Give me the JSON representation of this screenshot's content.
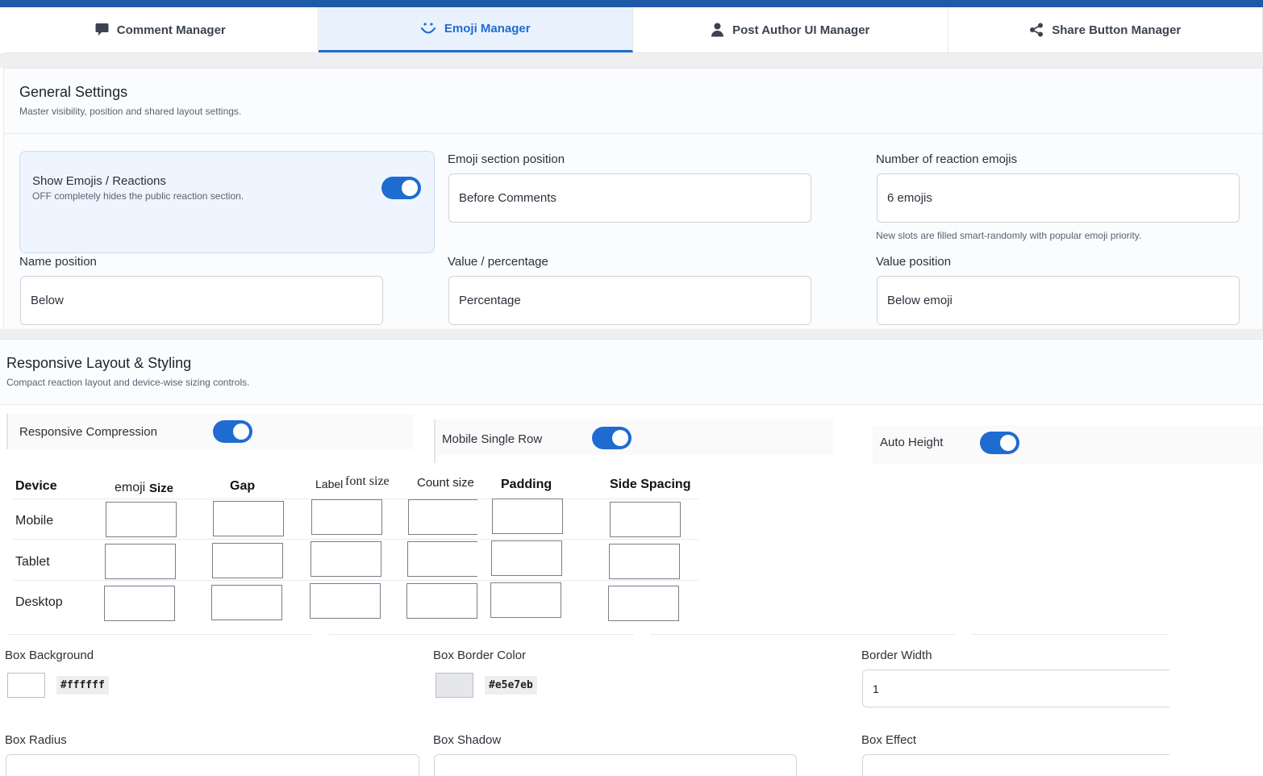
{
  "tabs": [
    {
      "label": "Comment Manager",
      "icon": "comment-icon",
      "active": false
    },
    {
      "label": "Emoji Manager",
      "icon": "smile-icon",
      "active": true
    },
    {
      "label": "Post Author UI Manager",
      "icon": "user-icon",
      "active": false
    },
    {
      "label": "Share Button Manager",
      "icon": "share-icon",
      "active": false
    }
  ],
  "general": {
    "title": "General Settings",
    "subtitle": "Master visibility, position and shared layout settings.",
    "show_emojis": {
      "label": "Show Emojis / Reactions",
      "help": "OFF completely hides the public reaction section.",
      "enabled": true
    },
    "emoji_position": {
      "label": "Emoji section position",
      "value": "Before Comments"
    },
    "emoji_count": {
      "label": "Number of reaction emojis",
      "value": "6 emojis",
      "help": "New slots are filled smart-randomly with popular emoji priority."
    },
    "name_position": {
      "label": "Name position",
      "value": "Below"
    },
    "value_type": {
      "label": "Value / percentage",
      "value": "Percentage"
    },
    "value_position": {
      "label": "Value position",
      "value": "Below emoji"
    }
  },
  "responsive": {
    "title": "Responsive Layout & Styling",
    "subtitle": "Compact reaction layout and device-wise sizing controls.",
    "toggles": [
      {
        "label": "Responsive Compression",
        "enabled": true
      },
      {
        "label": "Mobile Single Row",
        "enabled": true
      },
      {
        "label": "Auto Height",
        "enabled": true
      }
    ],
    "table": {
      "headers": {
        "device": "Device",
        "emoji_a": "emoji",
        "emoji_b": "Size",
        "gap": "Gap",
        "label_a": "Label",
        "label_b": "font size",
        "count": "Count size",
        "padding": "Padding",
        "side": "Side Spacing"
      },
      "rows": [
        "Mobile",
        "Tablet",
        "Desktop"
      ]
    },
    "box_background": {
      "label": "Box Background",
      "value": "#ffffff",
      "color": "#ffffff"
    },
    "box_border_color": {
      "label": "Box Border Color",
      "value": "#e5e7eb",
      "color": "#e5e7eb"
    },
    "border_width": {
      "label": "Border Width",
      "value": "1"
    },
    "box_radius": {
      "label": "Box Radius"
    },
    "box_shadow": {
      "label": "Box Shadow"
    },
    "box_effect": {
      "label": "Box Effect"
    }
  },
  "colors": {
    "accent": "#1f6cd1",
    "topbar": "#1e5aa8"
  }
}
